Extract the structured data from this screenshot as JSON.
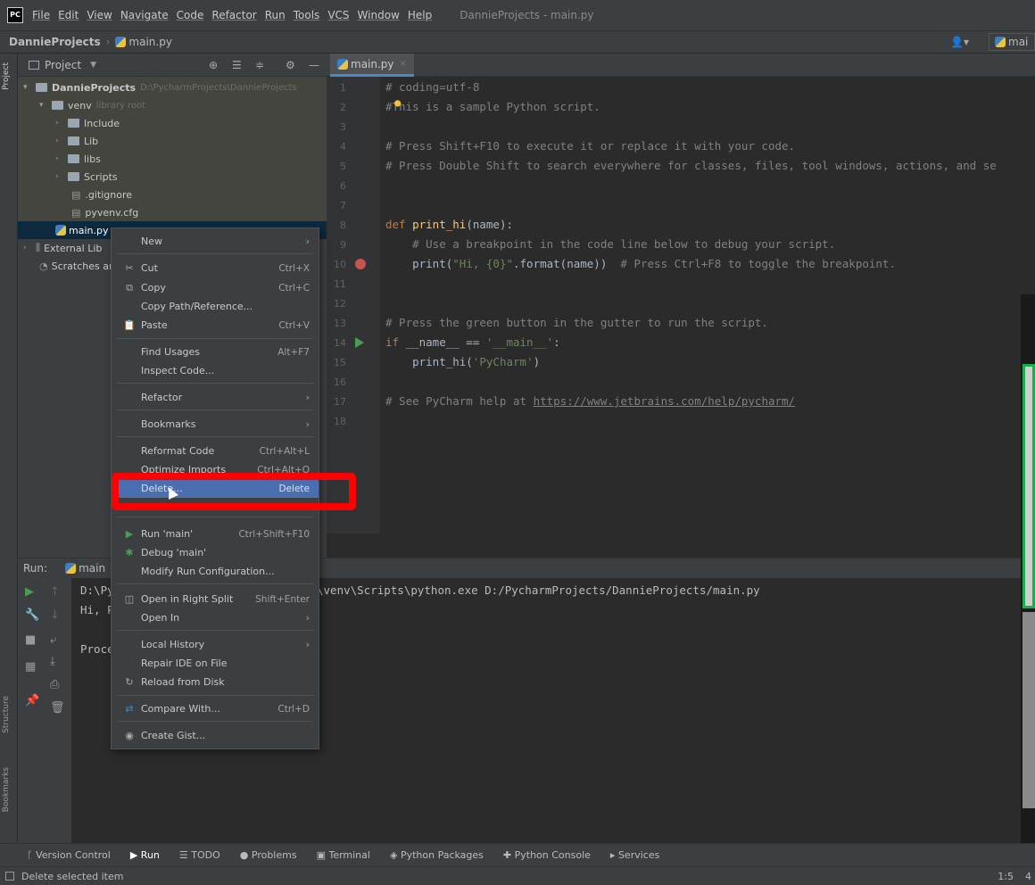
{
  "menubar": {
    "logo": "PC",
    "items": [
      "File",
      "Edit",
      "View",
      "Navigate",
      "Code",
      "Refactor",
      "Run",
      "Tools",
      "VCS",
      "Window",
      "Help"
    ],
    "window_title": "DannieProjects - main.py"
  },
  "navbar": {
    "project": "DannieProjects",
    "file": "main.py",
    "run_config": "mai"
  },
  "left_strip": {
    "project": "Project",
    "structure": "Structure",
    "bookmarks": "Bookmarks"
  },
  "project_panel": {
    "title": "Project",
    "tree": [
      {
        "label": "DannieProjects",
        "hint": "D:\\PycharmProjects\\DannieProjects"
      },
      {
        "label": "venv",
        "hint": "library root"
      },
      {
        "label": "Include"
      },
      {
        "label": "Lib"
      },
      {
        "label": "libs"
      },
      {
        "label": "Scripts"
      },
      {
        "label": ".gitignore"
      },
      {
        "label": "pyvenv.cfg"
      },
      {
        "label": "main.py"
      },
      {
        "label": "External Lib"
      },
      {
        "label": "Scratches ar"
      }
    ]
  },
  "editor": {
    "tab": "main.py",
    "line_numbers": [
      "1",
      "2",
      "3",
      "4",
      "5",
      "6",
      "7",
      "8",
      "9",
      "10",
      "11",
      "12",
      "13",
      "14",
      "15",
      "16",
      "17",
      "18"
    ],
    "lines": {
      "l1": "# coding=utf-8",
      "l2": "#This is a sample Python script.",
      "l4": "# Press Shift+F10 to execute it or replace it with your code.",
      "l5": "# Press Double Shift to search everywhere for classes, files, tool windows, actions, and se",
      "l8_kw": "def ",
      "l8_fn": "print_hi",
      "l8_rest": "(name):",
      "l9": "    # Use a breakpoint in the code line below to debug your script.",
      "l10_a": "    print(",
      "l10_str": "\"Hi, {0}\"",
      "l10_b": ".format(name))  ",
      "l10_cm": "# Press Ctrl+F8 to toggle the breakpoint.",
      "l13": "# Press the green button in the gutter to run the script.",
      "l14_kw": "if ",
      "l14_a": "__name__ == ",
      "l14_str": "'__main__'",
      "l14_b": ":",
      "l15_a": "    print_hi(",
      "l15_str": "'PyCharm'",
      "l15_b": ")",
      "l17_cm": "# See PyCharm help at ",
      "l17_link": "https://www.jetbrains.com/help/pycharm/"
    }
  },
  "run_panel": {
    "label": "Run:",
    "tab": "main",
    "output": {
      "line1_a": "D:\\Py",
      "line1_b": "\\venv\\Scripts\\python.exe D:/PycharmProjects/DannieProjects/main.py",
      "line2": "Hi, P",
      "line3": "Proce"
    }
  },
  "context_menu": {
    "new": "New",
    "cut": "Cut",
    "cut_sc": "Ctrl+X",
    "copy": "Copy",
    "copy_sc": "Ctrl+C",
    "copy_path": "Copy Path/Reference...",
    "paste": "Paste",
    "paste_sc": "Ctrl+V",
    "find_usages": "Find Usages",
    "find_usages_sc": "Alt+F7",
    "inspect": "Inspect Code...",
    "refactor": "Refactor",
    "bookmarks": "Bookmarks",
    "reformat": "Reformat Code",
    "reformat_sc": "Ctrl+Alt+L",
    "optimize": "Optimize Imports",
    "optimize_sc": "Ctrl+Alt+O",
    "delete": "Delete...",
    "delete_sc": "Delete",
    "run": "Run 'main'",
    "run_sc": "Ctrl+Shift+F10",
    "debug": "Debug 'main'",
    "modify_run": "Modify Run Configuration...",
    "open_split": "Open in Right Split",
    "open_split_sc": "Shift+Enter",
    "open_in": "Open In",
    "local_history": "Local History",
    "repair": "Repair IDE on File",
    "reload": "Reload from Disk",
    "compare": "Compare With...",
    "compare_sc": "Ctrl+D",
    "gist": "Create Gist..."
  },
  "bottom_tabs": [
    "Version Control",
    "Run",
    "TODO",
    "Problems",
    "Terminal",
    "Python Packages",
    "Python Console",
    "Services"
  ],
  "statusbar": {
    "message": "Delete selected item",
    "position": "1:5",
    "extra": "4"
  },
  "colors": {
    "accent": "#4b6eaf",
    "highlight_box": "#ff0000",
    "breakpoint": "#c75450",
    "run_green": "#499c54"
  }
}
